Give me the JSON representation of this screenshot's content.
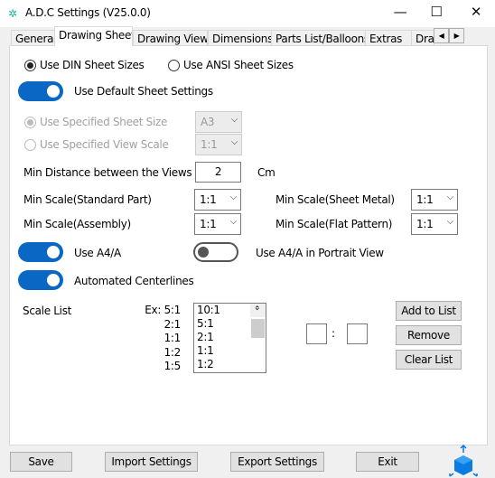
{
  "window": {
    "title": "A.D.C Settings (V25.0.0)",
    "minimize": "—",
    "maximize": "☐",
    "close": "✕"
  },
  "tabs": [
    "General",
    "Drawing Sheet",
    "Drawing Views",
    "Dimensions",
    "Parts List/Balloons",
    "Extras",
    "Draw"
  ],
  "active_tab": "Drawing Sheet",
  "sheet": {
    "din": "Use DIN Sheet Sizes",
    "ansi": "Use ANSI Sheet Sizes",
    "selected_standard": "DIN",
    "default_toggle": "Use Default Sheet Settings",
    "default_on": true,
    "spec_size": "Use Specified Sheet Size",
    "spec_size_value": "A3",
    "spec_scale": "Use Specified View Scale",
    "spec_scale_value": "1:1",
    "min_distance_label": "Min Distance between the Views",
    "min_distance": "2",
    "unit": "Cm",
    "std_part_label": "Min Scale(Standard Part)",
    "std_part": "1:1",
    "sheet_metal_label": "Min Scale(Sheet Metal)",
    "sheet_metal": "1:1",
    "assembly_label": "Min Scale(Assembly)",
    "assembly": "1:1",
    "flat_label": "Min Scale(Flat Pattern)",
    "flat": "1:1",
    "a4_label": "Use A4/A",
    "a4_on": true,
    "a4p_label": "Use A4/A in Portrait View",
    "a4p_on": false,
    "center_label": "Automated Centerlines",
    "center_on": true,
    "scale_list_label": "Scale List",
    "examples": [
      "Ex: 5:1",
      "2:1",
      "1:1",
      "1:2",
      "1:5"
    ],
    "scale_list": [
      "10:1",
      "5:1",
      "2:1",
      "1:1",
      "1:2"
    ],
    "ratio_sep": ":",
    "add": "Add to List",
    "remove": "Remove",
    "clear": "Clear List"
  },
  "footer": {
    "save": "Save",
    "import": "Import Settings",
    "export": "Export Settings",
    "exit": "Exit"
  },
  "colors": {
    "accent": "#0a67c3"
  }
}
